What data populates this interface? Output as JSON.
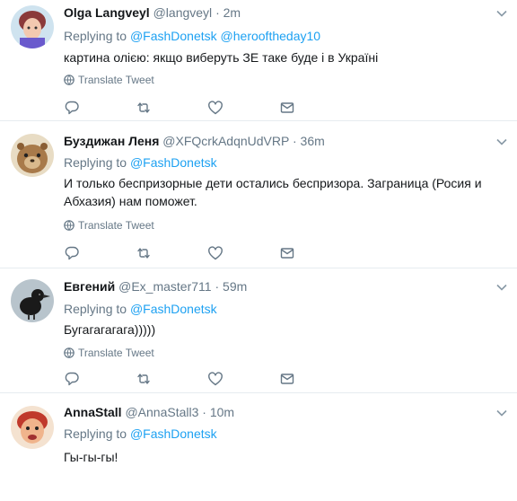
{
  "ui": {
    "replying_prefix": "Replying to",
    "translate_label": "Translate Tweet",
    "dot": "·"
  },
  "colors": {
    "link": "#1da1f2",
    "secondary": "#657786",
    "divider": "#e6ecf0",
    "text": "#14171a"
  },
  "tweets": [
    {
      "name": "Olga Langveyl",
      "handle": "@langveyl",
      "time": "2m",
      "mentions": [
        "@FashDonetsk",
        "@herooftheday10"
      ],
      "text": "картина олією: якщо виберуть ЗЕ таке буде і в Україні",
      "avatar_icon": "avatar-woman-icon"
    },
    {
      "name": "Буздижан Леня",
      "handle": "@XFQcrkAdqnUdVRP",
      "time": "36m",
      "mentions": [
        "@FashDonetsk"
      ],
      "text": "И только беспризорные дети остались беспризора. Заграница (Росия и Абхазия) нам поможет.",
      "avatar_icon": "avatar-groundhog-icon"
    },
    {
      "name": "Евгений",
      "handle": "@Ex_master711",
      "time": "59m",
      "mentions": [
        "@FashDonetsk"
      ],
      "text": "Бугагагагага)))))",
      "avatar_icon": "avatar-crow-icon"
    },
    {
      "name": "AnnaStall",
      "handle": "@AnnaStall3",
      "time": "10m",
      "mentions": [
        "@FashDonetsk"
      ],
      "text": "Гы-гы-гы!",
      "avatar_icon": "avatar-face-icon"
    }
  ]
}
